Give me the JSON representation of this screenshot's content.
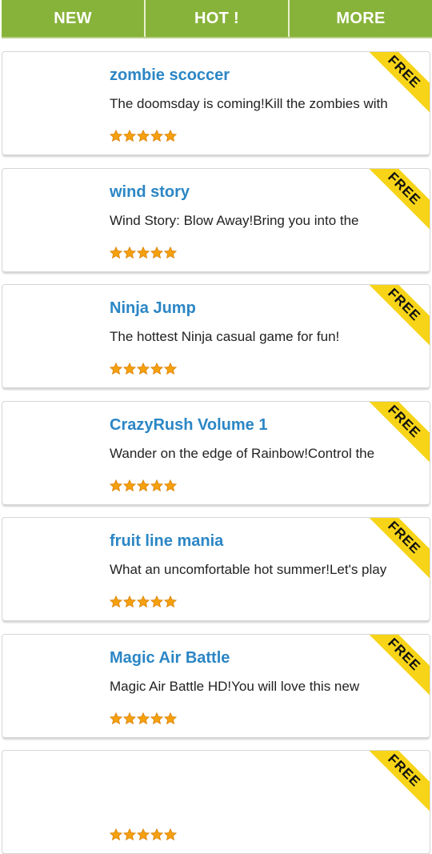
{
  "tabs": [
    {
      "label": "NEW"
    },
    {
      "label": "HOT !"
    },
    {
      "label": "MORE"
    }
  ],
  "colors": {
    "tab_bar": "#88b33a",
    "title": "#2b86c5",
    "star": "#f5a00f",
    "ribbon": "#f7d417"
  },
  "apps": [
    {
      "title": "zombie scoccer",
      "description": "The doomsday is coming!Kill the zombies with",
      "badge": "FREE",
      "rating": 5
    },
    {
      "title": "wind story",
      "description": "Wind Story: Blow Away!Bring you into the",
      "badge": "FREE",
      "rating": 5
    },
    {
      "title": "Ninja Jump",
      "description": "The hottest Ninja casual game for fun!",
      "badge": "FREE",
      "rating": 5
    },
    {
      "title": "CrazyRush Volume 1",
      "description": "Wander on the edge of Rainbow!Control the",
      "badge": "FREE",
      "rating": 5
    },
    {
      "title": "fruit line mania",
      "description": "What an uncomfortable hot summer!Let's play",
      "badge": "FREE",
      "rating": 5
    },
    {
      "title": "Magic Air Battle",
      "description": "Magic Air Battle HD!You will love this new",
      "badge": "FREE",
      "rating": 5
    },
    {
      "title": "",
      "description": "",
      "badge": "FREE",
      "rating": 5
    }
  ]
}
